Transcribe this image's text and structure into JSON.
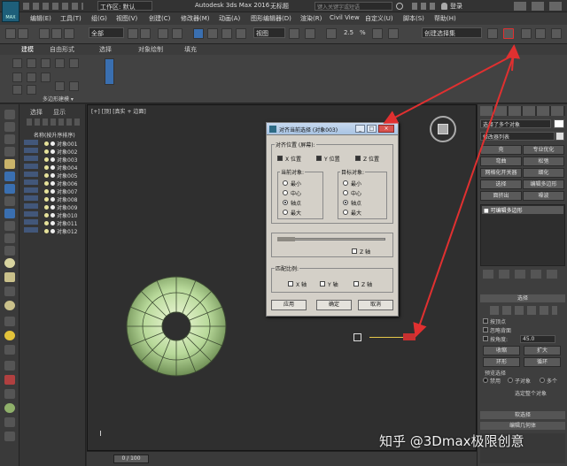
{
  "app": {
    "logo_text": "MAX",
    "workspace": "工作区: 默认",
    "title": "Autodesk 3ds Max 2016",
    "doc_title": "无标题",
    "search_placeholder": "键入关键字或短语",
    "login": "登录"
  },
  "menu": [
    "编辑(E)",
    "工具(T)",
    "组(G)",
    "视图(V)",
    "创建(C)",
    "修改器(M)",
    "动画(A)",
    "图形编辑器(D)",
    "渲染(R)",
    "Civil View",
    "自定义(U)",
    "脚本(S)",
    "帮助(H)"
  ],
  "toolbar": {
    "filter": "全部",
    "ref_coord": "视图",
    "selection_set": "创建选择集",
    "num_a": "2.5",
    "num_b": "%"
  },
  "ribbon": {
    "tabs": [
      "建模",
      "自由形式",
      "选择",
      "对象绘制",
      "填充"
    ],
    "panel_label": "多边形建模"
  },
  "scene": {
    "tabs": [
      "选择",
      "显示"
    ],
    "header": "名称(按升序排序)",
    "objects": [
      "对象001",
      "对象002",
      "对象003",
      "对象004",
      "对象005",
      "对象006",
      "对象007",
      "对象008",
      "对象009",
      "对象010",
      "对象011",
      "对象012"
    ]
  },
  "viewport": {
    "label": "[+] [顶] [真实 + 边面]"
  },
  "dialog": {
    "title": "对齐当前选择 (对象003)",
    "align_position_label": "对齐位置 (屏幕):",
    "x_label": "X 位置",
    "y_label": "Y 位置",
    "z_label": "Z 位置",
    "current_object_label": "当前对象:",
    "target_object_label": "目标对象:",
    "options": [
      "最小",
      "中心",
      "轴点",
      "最大"
    ],
    "current_selected": "轴点",
    "target_selected": "轴点",
    "orient_z": "Z 轴",
    "match_scale_label": "匹配比例:",
    "scale_x": "X 轴",
    "scale_y": "Y 轴",
    "scale_z": "Z 轴",
    "apply": "应用",
    "ok": "确定",
    "cancel": "取消",
    "btn_min": "_",
    "btn_max": "□",
    "btn_close": "×"
  },
  "command_panel": {
    "object_name": "选择了多个对象",
    "modifier_list": "修改器列表",
    "buttons": [
      "壳",
      "专业优化",
      "弯曲",
      "松弛",
      "网格化开关器",
      "细化",
      "选择",
      "编辑多边形",
      "面挤出",
      "噪波"
    ],
    "stack_item": "可编辑多边形",
    "rollout_selection": "选择",
    "by_vertex": "按顶点",
    "ignore_backface": "忽略背面",
    "by_angle": "按角度:",
    "angle_value": "45.0",
    "shrink": "收缩",
    "grow": "扩大",
    "ring": "环形",
    "loop": "循环",
    "preview_selection": "预览选择",
    "disabled": "禁用",
    "sub_object": "子对象",
    "multi": "多个",
    "whole_object": "选定整个对象",
    "soft_selection": "软选择",
    "edit_geometry": "编辑几何体"
  },
  "timeline": {
    "frame": "0 / 100"
  },
  "watermark": "知乎 @3Dmax极限创意",
  "colors": {
    "arrow": "#e03030",
    "torus": "#b8d99a",
    "accent": "#3a6fb0"
  }
}
